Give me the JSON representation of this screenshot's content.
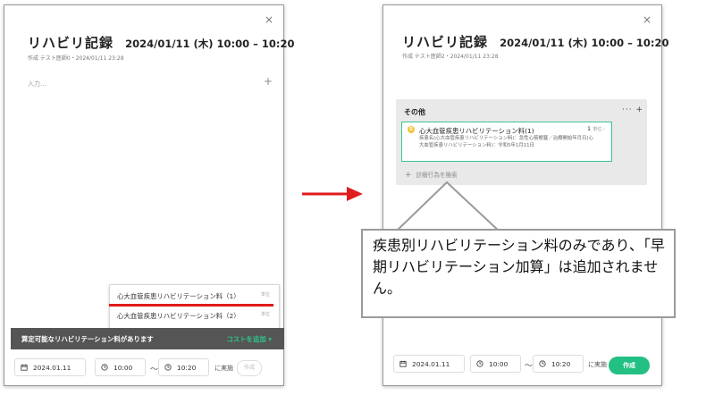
{
  "left_panel": {
    "close": "×",
    "title": "リハビリ記録",
    "datetime": "2024/01/11 (木) 10:00 – 10:20",
    "meta": "作成 テスト医師0・2024/01/11 23:28",
    "input_placeholder": "入力...",
    "plus": "+",
    "popup_items": [
      {
        "label": "心大血管疾患リハビリテーション料（1）",
        "unit": "単位"
      },
      {
        "label": "心大血管疾患リハビリテーション料（2）",
        "unit": "単位"
      }
    ],
    "notice": "算定可能なリハビリテーション料があります",
    "add_cost": "コストを追加 ▾",
    "footer": {
      "date": "2024.01.11",
      "start": "10:00",
      "tilde": "〜",
      "end": "10:20",
      "jisshi": "に実施",
      "create": "作成"
    }
  },
  "right_panel": {
    "close": "×",
    "title": "リハビリ記録",
    "datetime": "2024/01/11 (木) 10:00 – 10:20",
    "meta": "作成 テスト医師2・2024/01/11 23:28",
    "section_title": "その他",
    "section_tools": "··· +",
    "item": {
      "icon": "S",
      "name": "心大血管疾患リハビリテーション料(1)",
      "qty": "1",
      "unit": "単位 ›",
      "desc": "疾患名(心大血管疾患リハビリテーション料)：急性心筋梗塞／治療開始年月日(心大血管疾患リハビリテーション料)：令和5年1月11日"
    },
    "search": "診療行為を検索",
    "search_plus": "+",
    "footer": {
      "date": "2024.01.11",
      "start": "10:00",
      "tilde": "〜",
      "end": "10:20",
      "jisshi": "に実施",
      "create": "作成"
    }
  },
  "callout": {
    "text": "疾患別リハビリテーション料のみであり、「早期リハビリテーション加算」は追加されません。"
  },
  "colors": {
    "accent_green": "#23c083",
    "highlight_red": "#e01b1b",
    "arrow_red": "#e01b1b"
  }
}
